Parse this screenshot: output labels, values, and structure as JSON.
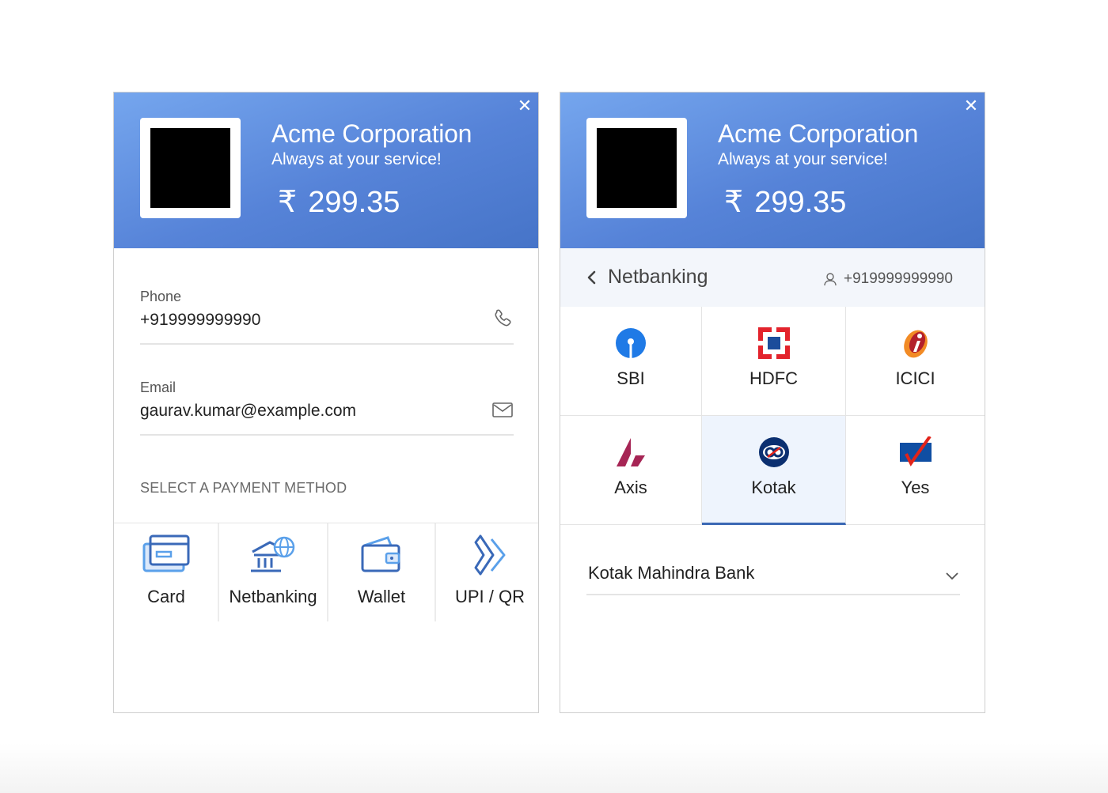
{
  "left": {
    "header": {
      "merchant_name": "Acme Corporation",
      "tagline": "Always at your service!",
      "currency_symbol": "₹",
      "amount": "299.35",
      "close_label": "✕"
    },
    "phone": {
      "label": "Phone",
      "value": "+919999999990",
      "icon": "phone-icon"
    },
    "email": {
      "label": "Email",
      "value": "gaurav.kumar@example.com",
      "icon": "mail-icon"
    },
    "section_title": "SELECT A PAYMENT METHOD",
    "methods": [
      {
        "label": "Card",
        "icon": "card-icon"
      },
      {
        "label": "Netbanking",
        "icon": "bank-globe-icon"
      },
      {
        "label": "Wallet",
        "icon": "wallet-icon"
      },
      {
        "label": "UPI / QR",
        "icon": "upi-icon"
      }
    ]
  },
  "right": {
    "header": {
      "merchant_name": "Acme Corporation",
      "tagline": "Always at your service!",
      "currency_symbol": "₹",
      "amount": "299.35",
      "close_label": "✕"
    },
    "nav": {
      "title": "Netbanking",
      "phone": "+919999999990"
    },
    "banks": [
      {
        "label": "SBI",
        "icon": "sbi-logo-icon"
      },
      {
        "label": "HDFC",
        "icon": "hdfc-logo-icon"
      },
      {
        "label": "ICICI",
        "icon": "icici-logo-icon"
      },
      {
        "label": "Axis",
        "icon": "axis-logo-icon"
      },
      {
        "label": "Kotak",
        "icon": "kotak-logo-icon",
        "selected": true
      },
      {
        "label": "Yes",
        "icon": "yes-logo-icon"
      }
    ],
    "bank_select": {
      "value": "Kotak Mahindra Bank"
    }
  },
  "colors": {
    "header_gradient_start": "#75a6ee",
    "header_gradient_end": "#4674c8",
    "accent": "#3b68b4",
    "icon_blue": "#3a69b8",
    "icon_light_blue": "#5aa0ea"
  }
}
